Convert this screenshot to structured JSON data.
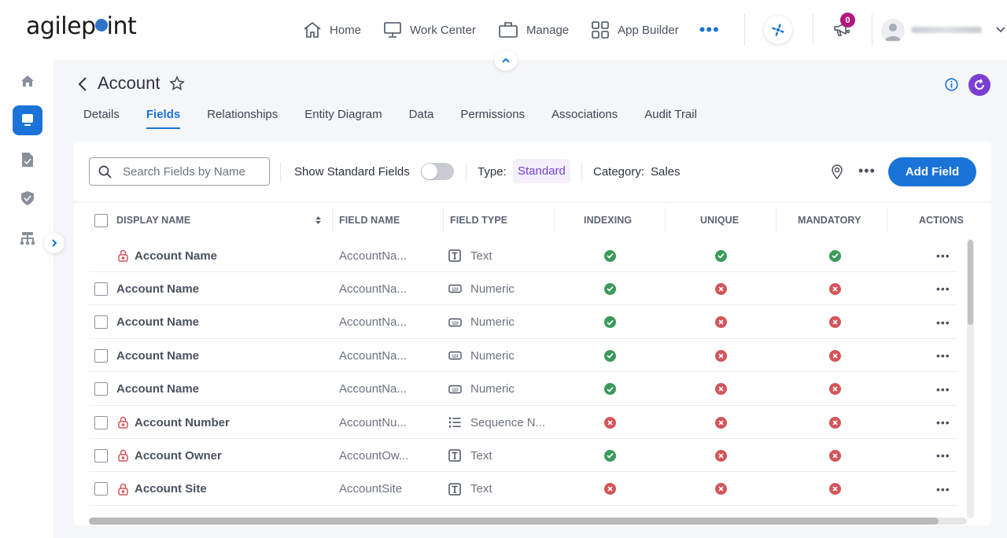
{
  "brand": {
    "logo_text_pre": "agilep",
    "logo_text_post": "int",
    "accent": "#1a73d6"
  },
  "topnav": {
    "items": [
      {
        "label": "Home",
        "icon": "home-icon"
      },
      {
        "label": "Work Center",
        "icon": "monitor-icon"
      },
      {
        "label": "Manage",
        "icon": "briefcase-icon"
      },
      {
        "label": "App Builder",
        "icon": "grid-icon"
      }
    ],
    "more_label": "•••",
    "notification_count": "0"
  },
  "page": {
    "title": "Account",
    "tabs": [
      {
        "label": "Details",
        "active": false
      },
      {
        "label": "Fields",
        "active": true
      },
      {
        "label": "Relationships",
        "active": false
      },
      {
        "label": "Entity Diagram",
        "active": false
      },
      {
        "label": "Data",
        "active": false
      },
      {
        "label": "Permissions",
        "active": false
      },
      {
        "label": "Associations",
        "active": false
      },
      {
        "label": "Audit Trail",
        "active": false
      }
    ]
  },
  "toolbar": {
    "search_placeholder": "Search Fields by Name",
    "search_value": "",
    "show_standard_label": "Show Standard Fields",
    "show_standard_on": false,
    "type_label": "Type:",
    "type_value": "Standard",
    "category_label": "Category:",
    "category_value": "Sales",
    "more_label": "•••",
    "add_label": "Add Field"
  },
  "table": {
    "columns": [
      "DISPLAY NAME",
      "FIELD NAME",
      "FIELD TYPE",
      "INDEXING",
      "UNIQUE",
      "MANDATORY",
      "ACTIONS"
    ],
    "rows": [
      {
        "checkbox": false,
        "locked": true,
        "display_name": "Account Name",
        "field_name": "AccountNa...",
        "field_type": "Text",
        "type_icon": "text",
        "indexing": true,
        "unique": true,
        "mandatory": true
      },
      {
        "checkbox": true,
        "locked": false,
        "display_name": "Account Name",
        "field_name": "AccountNa...",
        "field_type": "Numeric",
        "type_icon": "numeric",
        "indexing": true,
        "unique": false,
        "mandatory": false
      },
      {
        "checkbox": true,
        "locked": false,
        "display_name": "Account Name",
        "field_name": "AccountNa...",
        "field_type": "Numeric",
        "type_icon": "numeric",
        "indexing": true,
        "unique": false,
        "mandatory": false
      },
      {
        "checkbox": true,
        "locked": false,
        "display_name": "Account Name",
        "field_name": "AccountNa...",
        "field_type": "Numeric",
        "type_icon": "numeric",
        "indexing": true,
        "unique": false,
        "mandatory": false
      },
      {
        "checkbox": true,
        "locked": false,
        "display_name": "Account Name",
        "field_name": "AccountNa...",
        "field_type": "Numeric",
        "type_icon": "numeric",
        "indexing": true,
        "unique": false,
        "mandatory": false
      },
      {
        "checkbox": true,
        "locked": true,
        "display_name": "Account Number",
        "field_name": "AccountNu...",
        "field_type": "Sequence N...",
        "type_icon": "sequence",
        "indexing": false,
        "unique": false,
        "mandatory": false
      },
      {
        "checkbox": true,
        "locked": true,
        "display_name": "Account Owner",
        "field_name": "AccountOw...",
        "field_type": "Text",
        "type_icon": "text",
        "indexing": true,
        "unique": false,
        "mandatory": false
      },
      {
        "checkbox": true,
        "locked": true,
        "display_name": "Account Site",
        "field_name": "AccountSite",
        "field_type": "Text",
        "type_icon": "text",
        "indexing": false,
        "unique": false,
        "mandatory": false
      }
    ],
    "row_action_label": "•••"
  },
  "colors": {
    "yes": "#3a9a5a",
    "no": "#d2555a",
    "lock": "#d2555a",
    "type_chip": "#7a3ed1",
    "refresh": "#7b3fd4",
    "badge": "#b0197d"
  }
}
